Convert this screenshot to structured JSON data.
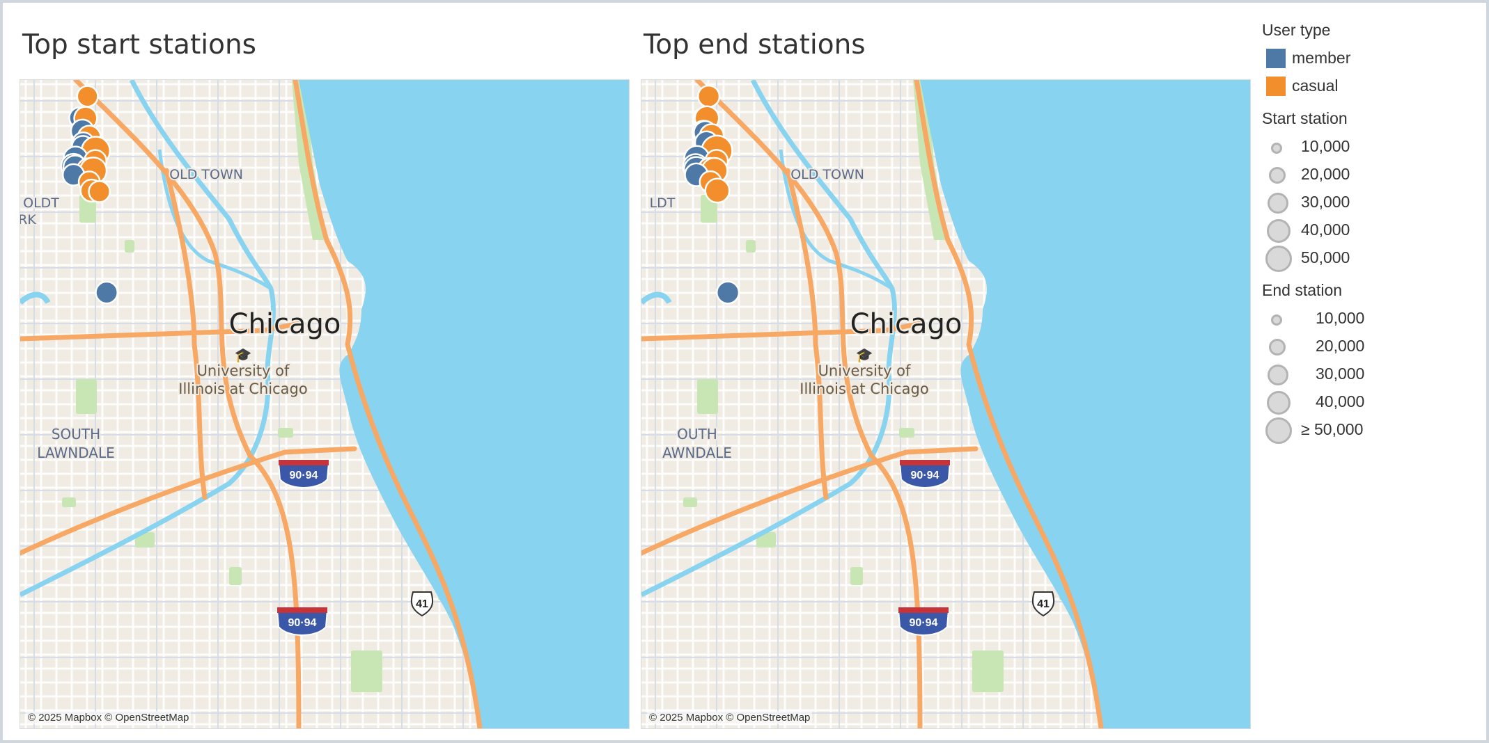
{
  "panels": [
    {
      "title": "Top start stations",
      "attribution": "© 2025 Mapbox © OpenStreetMap",
      "labels": {
        "city": "Chicago",
        "oldtown": "OLD TOWN",
        "oldtown2": "OLDT",
        "oldtown3": "RK",
        "university1": "University of",
        "university2": "Illinois at Chicago",
        "south": "SOUTH",
        "lawndale": "LAWNDALE",
        "interstate": "90·94",
        "us": "41"
      },
      "markers": [
        {
          "type": "casual",
          "lon": -87.6247,
          "lat": 41.9325,
          "count": 10000
        },
        {
          "type": "member",
          "lon": -87.6345,
          "lat": 41.9115,
          "count": 10000
        },
        {
          "type": "casual",
          "lon": -87.627,
          "lat": 41.911,
          "count": 16000
        },
        {
          "type": "member",
          "lon": -87.631,
          "lat": 41.8985,
          "count": 16000
        },
        {
          "type": "casual",
          "lon": -87.6225,
          "lat": 41.8925,
          "count": 16000
        },
        {
          "type": "member",
          "lon": -87.63,
          "lat": 41.8865,
          "count": 13000
        },
        {
          "type": "member",
          "lon": -87.6305,
          "lat": 41.883,
          "count": 13000
        },
        {
          "type": "casual",
          "lon": -87.6145,
          "lat": 41.879,
          "count": 38000
        },
        {
          "type": "member",
          "lon": -87.6395,
          "lat": 41.8715,
          "count": 20000
        },
        {
          "type": "casual",
          "lon": -87.615,
          "lat": 41.869,
          "count": 14000
        },
        {
          "type": "member",
          "lon": -87.642,
          "lat": 41.864,
          "count": 22000
        },
        {
          "type": "member",
          "lon": -87.64,
          "lat": 41.863,
          "count": 18000
        },
        {
          "type": "casual",
          "lon": -87.623,
          "lat": 41.86,
          "count": 20000
        },
        {
          "type": "casual",
          "lon": -87.6175,
          "lat": 41.8595,
          "count": 30000
        },
        {
          "type": "member",
          "lon": -87.642,
          "lat": 41.8555,
          "count": 12000
        },
        {
          "type": "casual",
          "lon": -87.6225,
          "lat": 41.8485,
          "count": 11000
        },
        {
          "type": "casual",
          "lon": -87.6195,
          "lat": 41.84,
          "count": 14000
        },
        {
          "type": "casual",
          "lon": -87.61,
          "lat": 41.839,
          "count": 11000
        },
        {
          "type": "member",
          "lon": -87.601,
          "lat": 41.74,
          "count": 13000
        }
      ]
    },
    {
      "title": "Top end stations",
      "attribution": "© 2025 Mapbox © OpenStreetMap",
      "labels": {
        "city": "Chicago",
        "oldtown": "OLD TOWN",
        "oldtown2": "LDT",
        "oldtown3": "",
        "university1": "University of",
        "university2": "Illinois at Chicago",
        "south": "OUTH",
        "lawndale": "AWNDALE",
        "interstate": "90·94",
        "us": "41"
      },
      "markers": [
        {
          "type": "casual",
          "lon": -87.6247,
          "lat": 41.9325,
          "count": 12000
        },
        {
          "type": "member",
          "lon": -87.631,
          "lat": 41.911,
          "count": 10000
        },
        {
          "type": "casual",
          "lon": -87.627,
          "lat": 41.911,
          "count": 20000
        },
        {
          "type": "member",
          "lon": -87.631,
          "lat": 41.8975,
          "count": 16000
        },
        {
          "type": "member",
          "lon": -87.629,
          "lat": 41.897,
          "count": 16000
        },
        {
          "type": "casual",
          "lon": -87.621,
          "lat": 41.8935,
          "count": 20000
        },
        {
          "type": "member",
          "lon": -87.6275,
          "lat": 41.887,
          "count": 16000
        },
        {
          "type": "casual",
          "lon": -87.6145,
          "lat": 41.879,
          "count": 50000
        },
        {
          "type": "member",
          "lon": -87.6395,
          "lat": 41.8715,
          "count": 24000
        },
        {
          "type": "casual",
          "lon": -87.615,
          "lat": 41.869,
          "count": 15000
        },
        {
          "type": "member",
          "lon": -87.641,
          "lat": 41.8635,
          "count": 24000
        },
        {
          "type": "member",
          "lon": -87.64,
          "lat": 41.861,
          "count": 22000
        },
        {
          "type": "casual",
          "lon": -87.623,
          "lat": 41.86,
          "count": 22000
        },
        {
          "type": "casual",
          "lon": -87.6175,
          "lat": 41.8595,
          "count": 26000
        },
        {
          "type": "member",
          "lon": -87.64,
          "lat": 41.8555,
          "count": 16000
        },
        {
          "type": "casual",
          "lon": -87.6225,
          "lat": 41.8485,
          "count": 12000
        },
        {
          "type": "casual",
          "lon": -87.614,
          "lat": 41.84,
          "count": 20000
        },
        {
          "type": "member",
          "lon": -87.601,
          "lat": 41.74,
          "count": 14000
        }
      ]
    }
  ],
  "colors": {
    "member": "#4e79a7",
    "casual": "#f28e2b",
    "water": "#88d3f0",
    "land": "#f0ebe3",
    "highway": "#f7a864",
    "street": "#ffffff",
    "park": "#c8e6b3"
  },
  "legend": {
    "user_type": {
      "title": "User type",
      "items": [
        {
          "label": "member",
          "color": "#4e79a7"
        },
        {
          "label": "casual",
          "color": "#f28e2b"
        }
      ]
    },
    "start_station": {
      "title": "Start station",
      "items": [
        {
          "label": "10,000",
          "value": 10000
        },
        {
          "label": "20,000",
          "value": 20000
        },
        {
          "label": "30,000",
          "value": 30000
        },
        {
          "label": "40,000",
          "value": 40000
        },
        {
          "label": "50,000",
          "value": 50000
        }
      ]
    },
    "end_station": {
      "title": "End station",
      "items": [
        {
          "label": "10,000",
          "value": 10000
        },
        {
          "label": "20,000",
          "value": 20000
        },
        {
          "label": "30,000",
          "value": 30000
        },
        {
          "label": "40,000",
          "value": 40000
        },
        {
          "label": "≥ 50,000",
          "value": 50000
        }
      ]
    }
  }
}
